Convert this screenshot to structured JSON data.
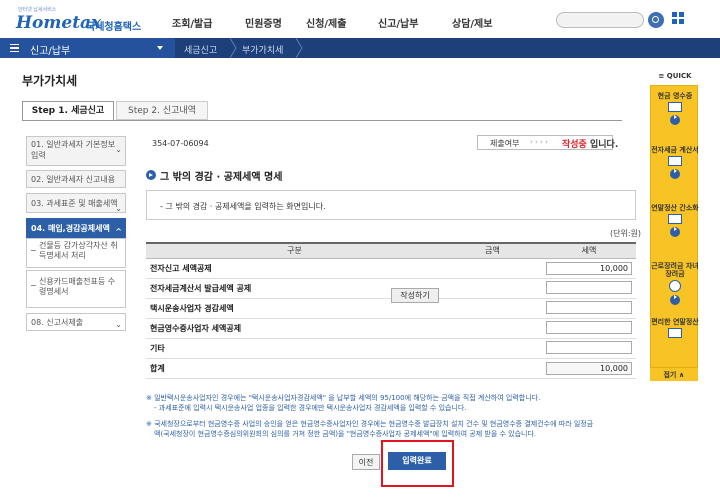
{
  "header": {
    "logo_tagline": "안터넷 납세서비스",
    "logo_main": "Hometax",
    "logo_kr": "국세청홈택스",
    "menu": [
      "조회/발급",
      "민원증명",
      "신청/제출",
      "신고/납부",
      "상담/제보"
    ]
  },
  "nav": {
    "section": "신고/납부",
    "breadcrumbs": [
      "세금신고",
      "부가가치세"
    ]
  },
  "page": {
    "title": "부가가치세",
    "tabs": [
      "Step 1. 세금신고",
      "Step 2. 신고내역"
    ]
  },
  "steps": [
    "01. 일반과세자 기본정보 입력",
    "02. 일반과세자 신고내용",
    "03. 과세표준 및 매출세액",
    "04. 매입,경감공제세액",
    "건물등 감가상각자산 취득명세서 처리",
    "신용카드매출전표등 수령명세서",
    "08. 신고서제출"
  ],
  "content": {
    "biz_no": "354-07-06094",
    "status_label": "제출여부",
    "status_dots": "› › › ›",
    "status_value": "작성중",
    "status_tail": "입니다.",
    "section_title": "그 밖의 경감 · 공제세액 명세",
    "info": "- 그 밖의 경감 · 공제세액을 입력하는 화면입니다.",
    "unit": "(단위:원)"
  },
  "table": {
    "headers": [
      "구분",
      "금액",
      "세액"
    ],
    "rows": [
      {
        "label": "전자신고 세액공제",
        "tax": "10,000"
      },
      {
        "label": "전자세금계산서 발급세액 공제",
        "tax": "",
        "button": "작성하기"
      },
      {
        "label": "택시운송사업자 경감세액",
        "tax": ""
      },
      {
        "label": "현금영수증사업자 세액공제",
        "tax": ""
      },
      {
        "label": "기타",
        "tax": ""
      },
      {
        "label": "합계",
        "tax": "10,000"
      }
    ]
  },
  "notes": [
    "※ 일반택시운송사업자인 경우에는 \"택시운송사업자경감세액\" 을 납부할 세액의 95/100에 해당하는 금액을 직접 계산하여 입력합니다.",
    "- 과세표준에 입력시 택시운송사업 업종을 입력한 경우에만 택시운송사업자 경감세액을 입력할 수 있습니다.",
    "※ 국세청장으로부터 현금영수증 사업의 승인을 얻은 현금영수증사업자인 경우에는 현금영수증 발급장치 설치 건수 및 현금영수증 결제건수에 따라 일정금",
    "액(국세청장이 현금영수증심의위원회의 심의를 거쳐 정한 금액)을 \"현금영수증사업자 공제세액\"에 입력하여 공제 받을 수 있습니다."
  ],
  "buttons": {
    "prev": "이전",
    "done": "입력완료"
  },
  "quick": {
    "head": "≡ QUICK",
    "items": [
      "현금 영수증",
      "전자세금 계산서",
      "연말정산 간소화",
      "근로장려금 자녀장려금",
      "편리한 연말정산"
    ],
    "foot": "접기 ∧"
  }
}
